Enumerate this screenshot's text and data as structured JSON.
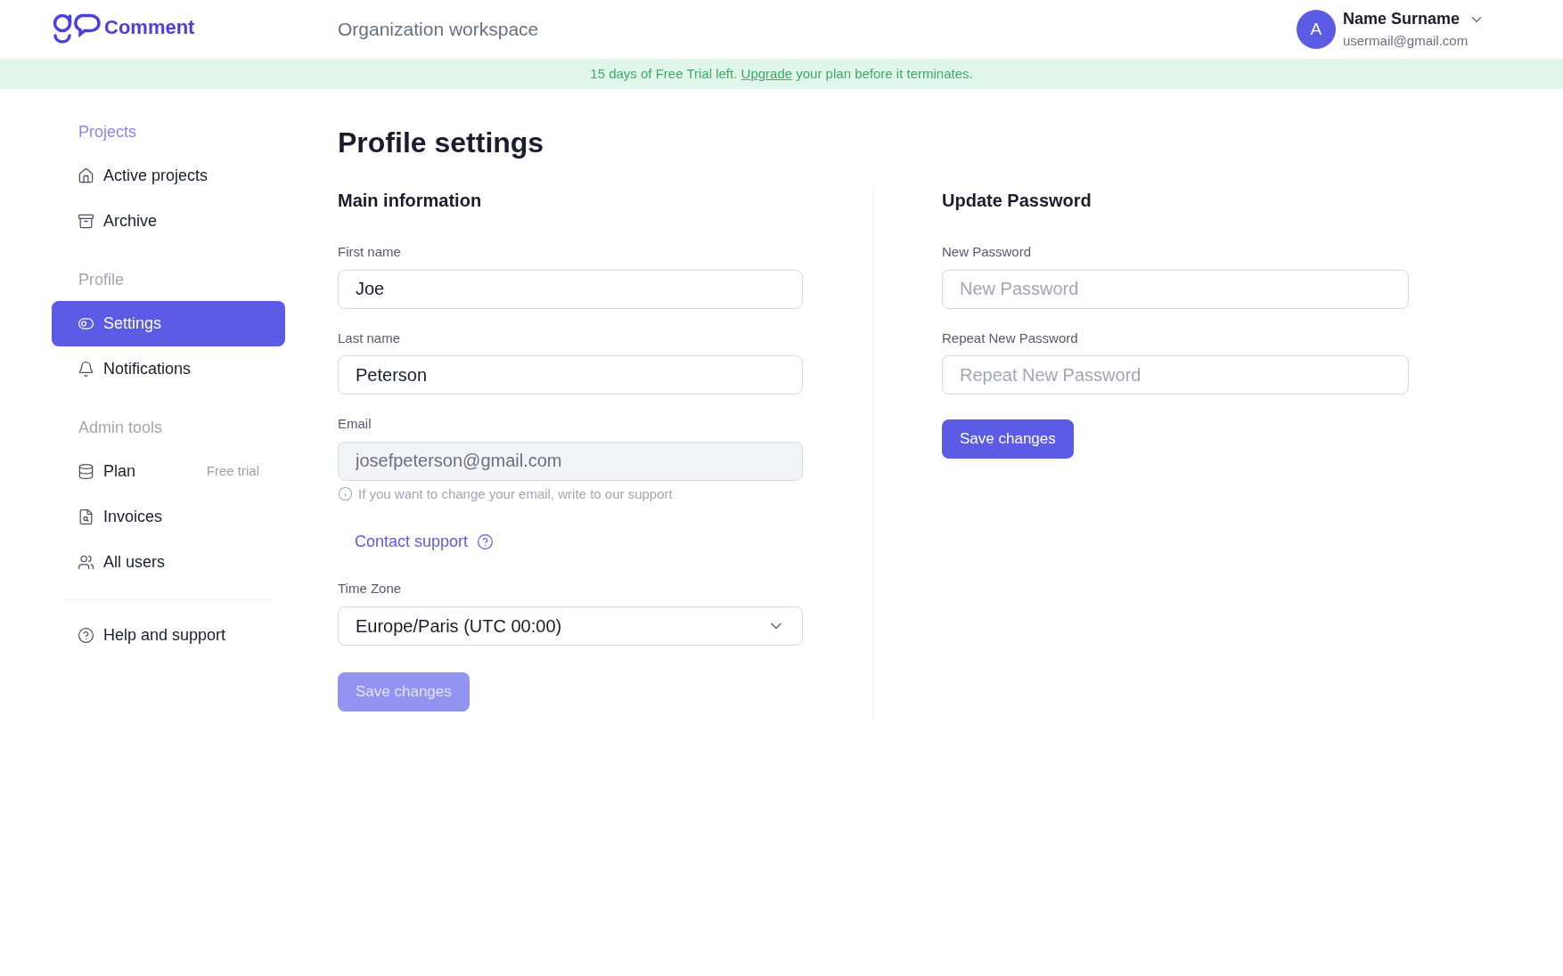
{
  "header": {
    "logo_text": "Comment",
    "workspace": "Organization workspace",
    "user": {
      "initial": "A",
      "name": "Name Surname",
      "email": "usermail@gmail.com"
    }
  },
  "banner": {
    "before": "15 days of Free Trial left.",
    "link": "Upgrade",
    "after": "your plan before it terminates."
  },
  "sidebar": {
    "sections": [
      {
        "title": "Projects",
        "active": true,
        "items": [
          {
            "kind": "home",
            "label": "Active projects",
            "selected": false
          },
          {
            "kind": "archive",
            "label": "Archive",
            "selected": false
          }
        ]
      },
      {
        "title": "Profile",
        "active": false,
        "items": [
          {
            "kind": "settings",
            "label": "Settings",
            "selected": true
          },
          {
            "kind": "bell",
            "label": "Notifications",
            "selected": false
          }
        ]
      },
      {
        "title": "Admin tools",
        "active": false,
        "items": [
          {
            "kind": "database",
            "label": "Plan",
            "badge": "Free trial",
            "selected": false
          },
          {
            "kind": "invoice",
            "label": "Invoices",
            "selected": false
          },
          {
            "kind": "users",
            "label": "All users",
            "selected": false
          }
        ]
      }
    ],
    "footer_item": {
      "kind": "help",
      "label": "Help and support",
      "selected": false
    }
  },
  "page_title": "Profile settings",
  "main_information": {
    "heading": "Main information",
    "fields": [
      {
        "label": "First name",
        "value": "Joe",
        "disabled": false
      },
      {
        "label": "Last name",
        "value": "Peterson",
        "disabled": false
      },
      {
        "label": "Email",
        "value": "josefpeterson@gmail.com",
        "disabled": true,
        "hint": "If you want to change your email, write to our support"
      }
    ],
    "contact_link": "Contact support",
    "time_zone": {
      "label": "Time Zone",
      "value": "Europe/Paris (UTC 00:00)"
    },
    "save_button": {
      "label": "Save changes",
      "disabled": true
    }
  },
  "update_password": {
    "heading": "Update Password",
    "fields": [
      {
        "label": "New Password",
        "placeholder": "New Password"
      },
      {
        "label": "Repeat New Password",
        "placeholder": "Repeat New Password"
      }
    ],
    "save_button": {
      "label": "Save changes",
      "disabled": false
    }
  }
}
